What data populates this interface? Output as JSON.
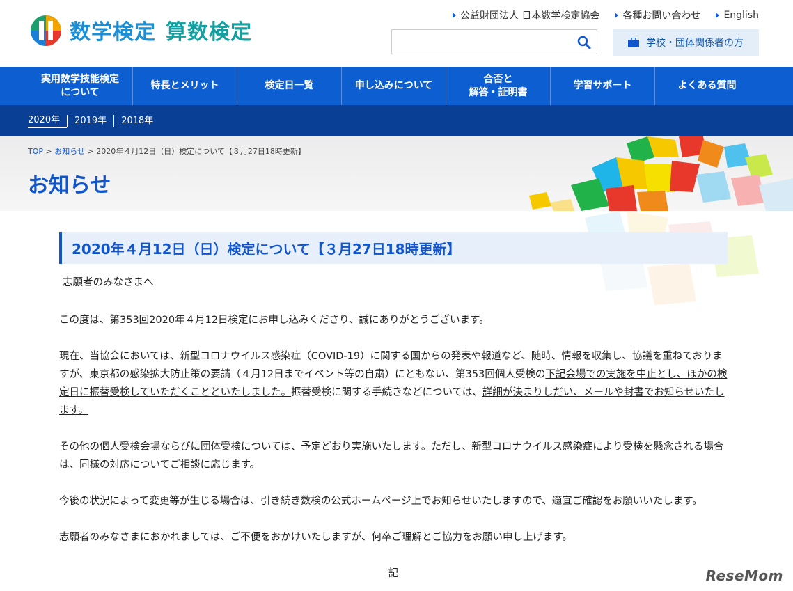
{
  "header": {
    "logo_text_1": "数学検定",
    "logo_text_2": "算数検定",
    "top_links": [
      "公益財団法人 日本数学検定協会",
      "各種お問い合わせ",
      "English"
    ],
    "search_placeholder": "",
    "school_button": "学校・団体関係者の方"
  },
  "main_nav": [
    "実用数学技能検定\nについて",
    "特長とメリット",
    "検定日一覧",
    "申し込みについて",
    "合否と\n解答・証明書",
    "学習サポート",
    "よくある質問"
  ],
  "sub_nav": [
    "2020年",
    "2019年",
    "2018年"
  ],
  "breadcrumb": {
    "top": "TOP",
    "sep": " > ",
    "news": "お知らせ",
    "current": "2020年４月12日（日）検定について【３月27日18時更新】"
  },
  "page_title": "お知らせ",
  "article": {
    "title": "2020年４月12日（日）検定について【３月27日18時更新】",
    "greeting": "志願者のみなさまへ",
    "p1": "この度は、第353回2020年４月12日検定にお申し込みくださり、誠にありがとうございます。",
    "p2_a": "現在、当協会においては、新型コロナウイルス感染症（COVID-19）に関する国からの発表や報道など、随時、情報を収集し、協議を重ねておりますが、東京都の感染拡大防止策の要請（４月12日までイベント等の自粛）にともない、第353回個人受検の",
    "p2_u1": "下記会場での実施を中止とし、ほかの検定日に振替受検していただくことといたしました。",
    "p2_b": "振替受検に関する手続きなどについては、",
    "p2_u2": "詳細が決まりしだい、メールや封書でお知らせいたします。",
    "p3": "その他の個人受検会場ならびに団体受検については、予定どおり実施いたします。ただし、新型コロナウイルス感染症により受検を懸念される場合は、同様の対応についてご相談に応じます。",
    "p4": "今後の状況によって変更等が生じる場合は、引き続き数検の公式ホームページ上でお知らせいたしますので、適宜ご確認をお願いいたします。",
    "p5": "志願者のみなさまにおかれましては、ご不便をおかけいたしますが、何卒ご理解とご協力をお願い申し上げます。",
    "ki": "記"
  },
  "watermark": "ReseMom",
  "colors": {
    "nav_blue": "#0d5fd1",
    "subnav_blue": "#0a3f96",
    "title_blue": "#1155cc"
  }
}
